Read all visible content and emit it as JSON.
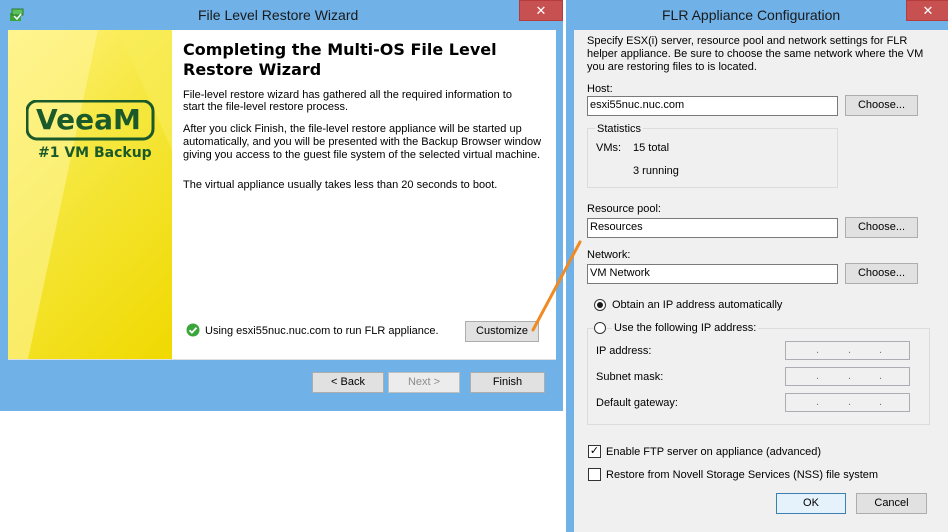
{
  "wizard": {
    "title": "File Level Restore Wizard",
    "close_glyph": "✕",
    "heading_line1": "Completing the Multi-OS File Level",
    "heading_line2": "Restore Wizard",
    "para1_line1": "File-level restore wizard has gathered all the required information to",
    "para1_line2": "start the file-level restore process.",
    "para2_line1": "After you click Finish, the file-level restore appliance will be started up",
    "para2_line2": "automatically, and you will be presented with the Backup Browser window",
    "para2_line3": "giving you access to the guest file system of the selected virtual machine.",
    "para3": "The virtual appliance usually takes less than 20 seconds to boot.",
    "status_text": "Using esxi55nuc.nuc.com to run FLR appliance.",
    "customize_label": "Customize",
    "back_label": "< Back",
    "next_label": "Next >",
    "finish_label": "Finish",
    "logo_text": "VeeaM",
    "logo_tagline": "#1 VM Backup"
  },
  "flr": {
    "title": "FLR Appliance Configuration",
    "close_glyph": "✕",
    "desc_line1": "Specify ESX(i) server, resource pool and network settings for FLR",
    "desc_line2": "helper appliance. Be sure to choose the same network where the VM",
    "desc_line3": "you are restoring files to is located.",
    "host_label": "Host:",
    "host_value": "esxi55nuc.nuc.com",
    "choose_label": "Choose...",
    "statistics_label": "Statistics",
    "vms_label": "VMs:",
    "vms_total": "15 total",
    "vms_running": "3 running",
    "resource_pool_label": "Resource pool:",
    "resource_pool_value": "Resources",
    "network_label": "Network:",
    "network_value": "VM Network",
    "obtain_ip_label": "Obtain an IP address automatically",
    "use_ip_label": "Use the following IP address:",
    "ip_address_label": "IP address:",
    "subnet_mask_label": "Subnet mask:",
    "default_gateway_label": "Default gateway:",
    "ip_dot": ".",
    "enable_ftp_label": "Enable FTP server on appliance (advanced)",
    "nss_label": "Restore from Novell Storage Services (NSS) file system",
    "ok_label": "OK",
    "cancel_label": "Cancel"
  },
  "colors": {
    "title_bar": "#70b1e8",
    "close_button": "#c75050",
    "banner_yellow": "#f5e63a",
    "logo_green": "#1a5a2a",
    "arrow_orange": "#f08a24",
    "status_green": "#3aa53a"
  }
}
